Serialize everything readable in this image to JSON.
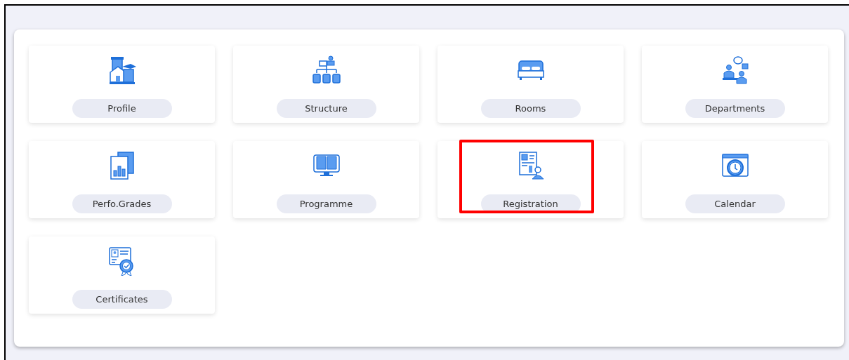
{
  "tiles": [
    {
      "label": "Profile",
      "highlighted": false
    },
    {
      "label": "Structure",
      "highlighted": false
    },
    {
      "label": "Rooms",
      "highlighted": false
    },
    {
      "label": "Departments",
      "highlighted": false
    },
    {
      "label": "Perfo.Grades",
      "highlighted": false
    },
    {
      "label": "Programme",
      "highlighted": false
    },
    {
      "label": "Registration",
      "highlighted": true
    },
    {
      "label": "Calendar",
      "highlighted": false
    },
    {
      "label": "Certificates",
      "highlighted": false
    }
  ]
}
